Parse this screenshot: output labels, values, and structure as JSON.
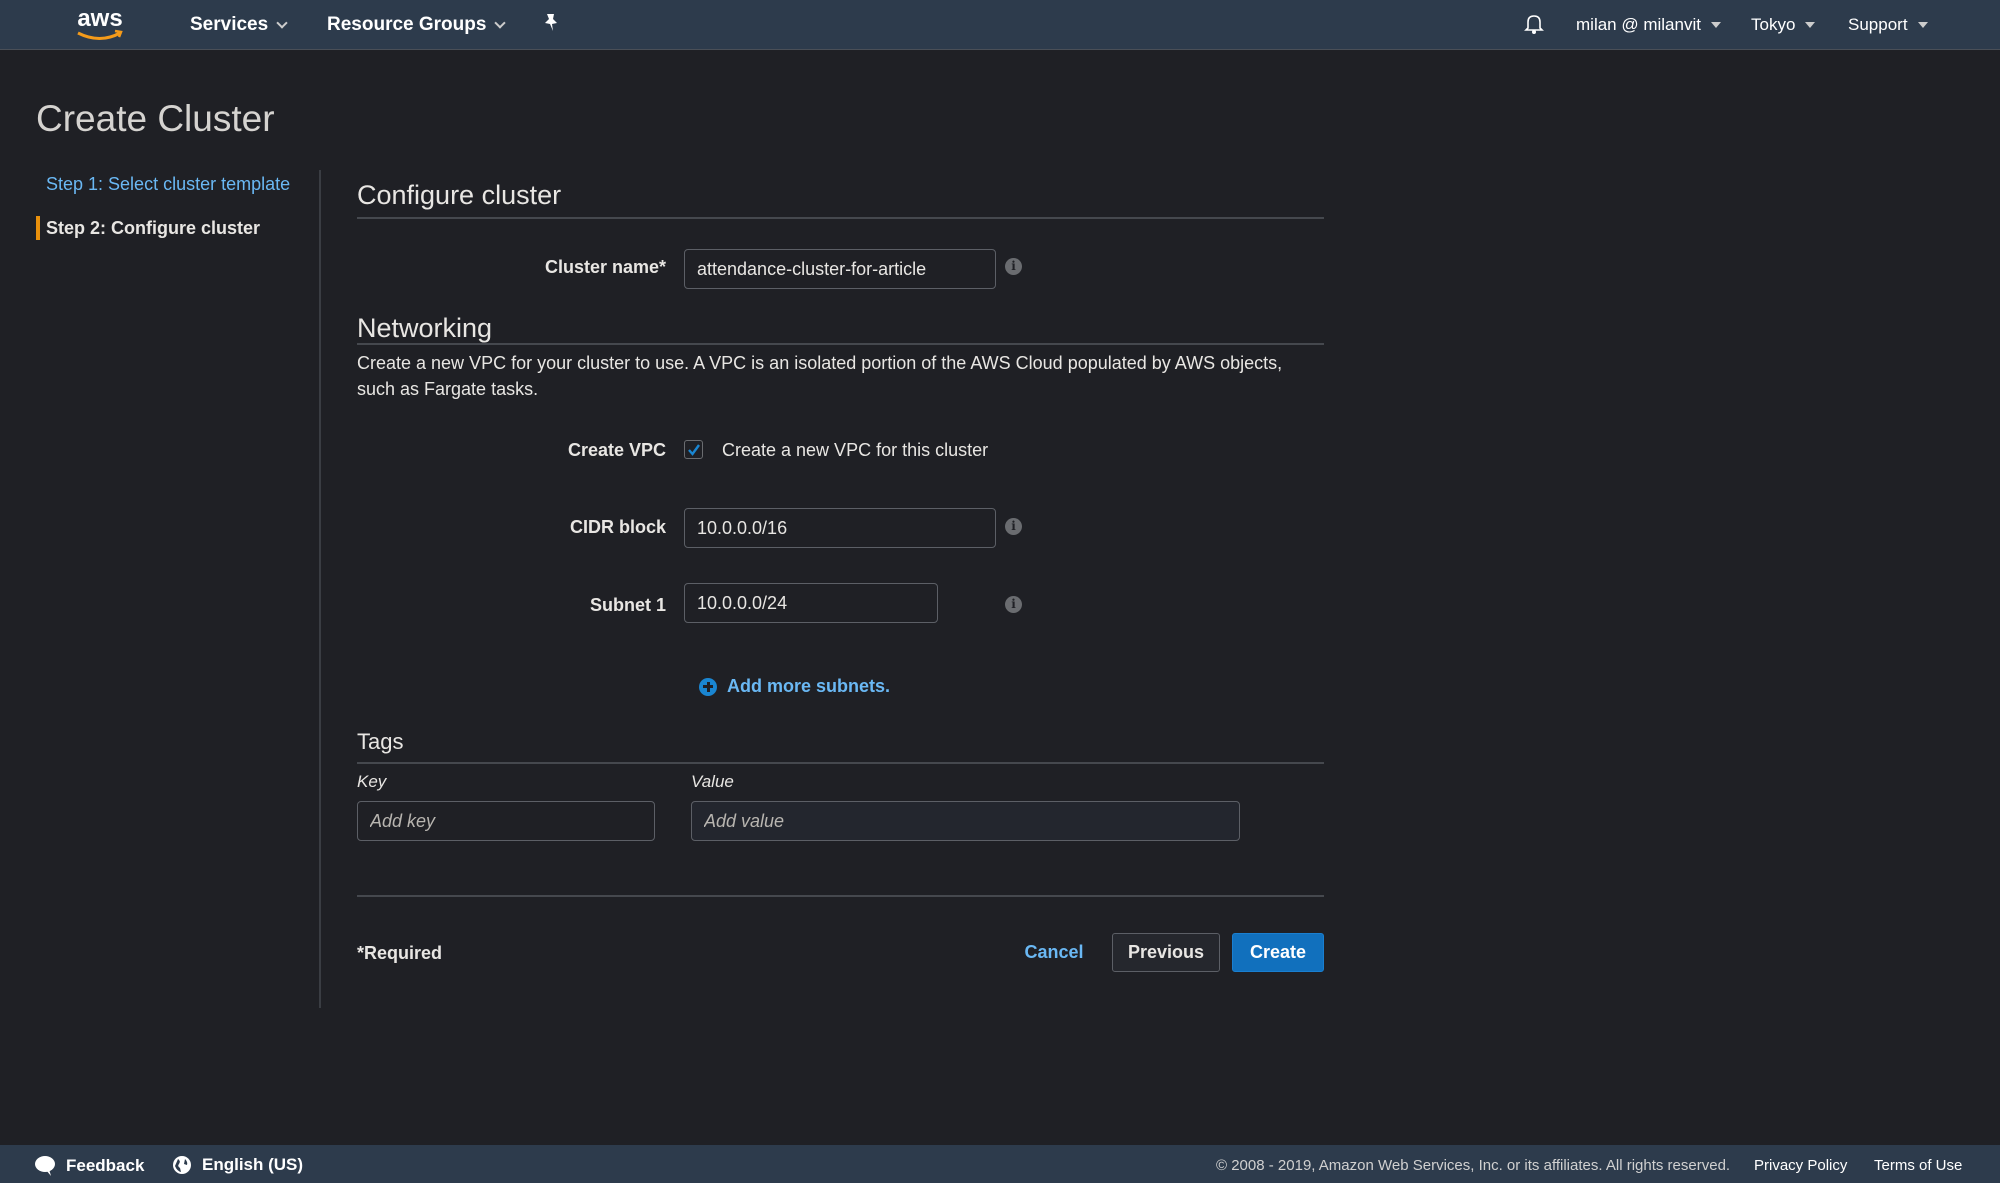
{
  "topnav": {
    "logo_text": "aws",
    "services": "Services",
    "resource_groups": "Resource Groups",
    "user": "milan @ milanvit",
    "region": "Tokyo",
    "support": "Support"
  },
  "page": {
    "title": "Create Cluster"
  },
  "steps": [
    {
      "label": "Step 1: Select cluster template",
      "state": "link"
    },
    {
      "label": "Step 2: Configure cluster",
      "state": "active"
    }
  ],
  "configure": {
    "title": "Configure cluster",
    "cluster_name_label": "Cluster name*",
    "cluster_name_value": "attendance-cluster-for-article"
  },
  "networking": {
    "title": "Networking",
    "description": "Create a new VPC for your cluster to use. A VPC is an isolated portion of the AWS Cloud populated by AWS objects, such as Fargate tasks.",
    "create_vpc_label": "Create VPC",
    "create_vpc_checked": true,
    "create_vpc_option": "Create a new VPC for this cluster",
    "cidr_label": "CIDR block",
    "cidr_value": "10.0.0.0/16",
    "subnet1_label": "Subnet 1",
    "subnet1_value": "10.0.0.0/24",
    "add_subnets": "Add more subnets."
  },
  "tags": {
    "title": "Tags",
    "key_label": "Key",
    "value_label": "Value",
    "key_placeholder": "Add key",
    "value_placeholder": "Add value"
  },
  "actions": {
    "required_note": "*Required",
    "cancel": "Cancel",
    "previous": "Previous",
    "create": "Create"
  },
  "colors": {
    "accent_link": "#6ab8f4",
    "primary_button": "#1170bd",
    "active_step_marker": "#e8900c",
    "nav_background": "#2d3b4c"
  },
  "footer": {
    "feedback": "Feedback",
    "language": "English (US)",
    "copyright": "© 2008 - 2019, Amazon Web Services, Inc. or its affiliates. All rights reserved.",
    "privacy": "Privacy Policy",
    "terms": "Terms of Use"
  }
}
